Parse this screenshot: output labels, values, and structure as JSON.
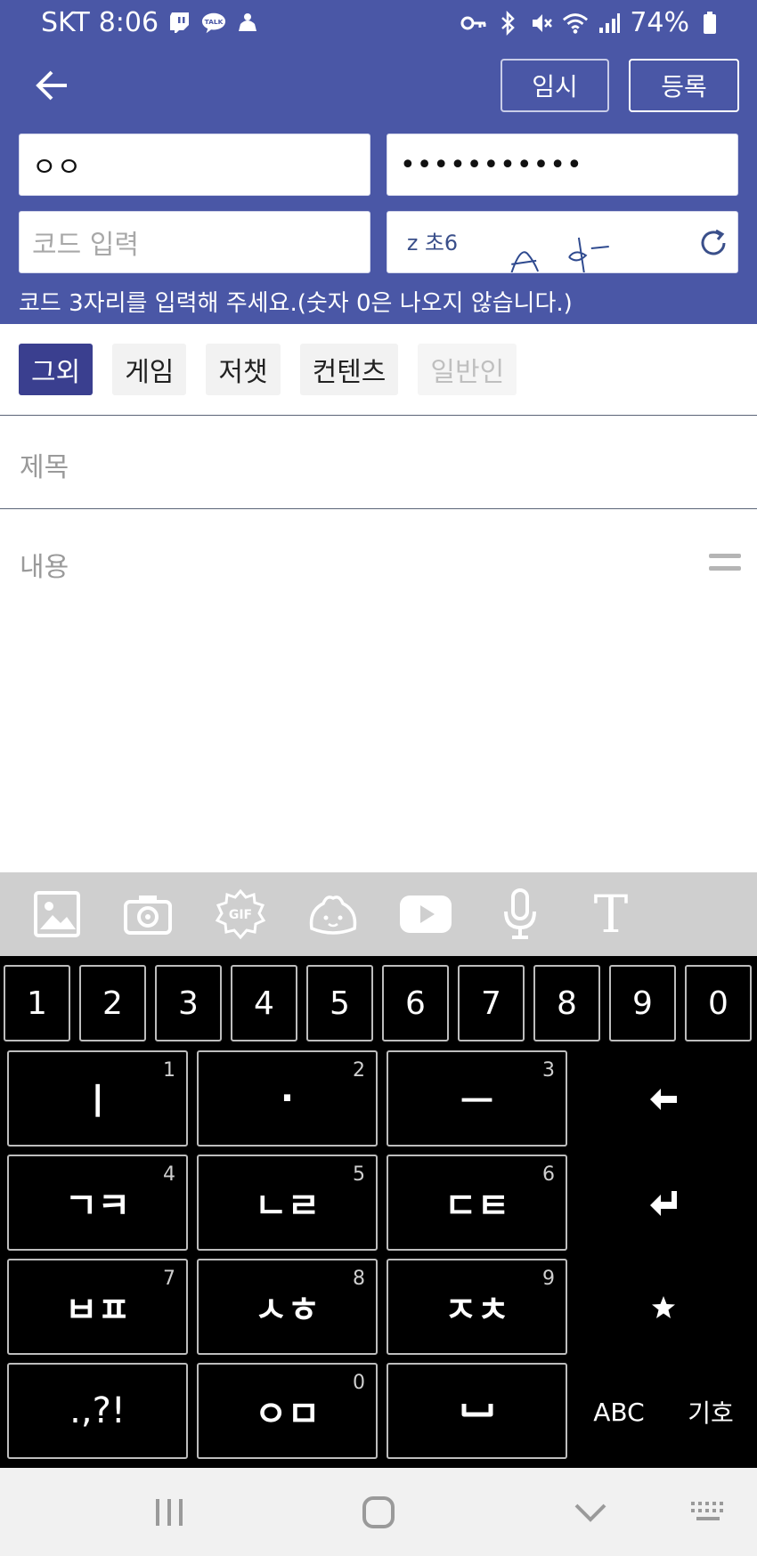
{
  "status_bar": {
    "carrier": "SKT",
    "time": "8:06",
    "battery": "74%",
    "left_icons": [
      "twitch-icon",
      "kakaotalk-icon",
      "notification-icon"
    ],
    "right_icons": [
      "key-icon",
      "bluetooth-icon",
      "mute-icon",
      "wifi-icon",
      "signal-icon",
      "battery-icon"
    ]
  },
  "header": {
    "temp_label": "임시",
    "submit_label": "등록"
  },
  "form": {
    "name_value": "ㅇㅇ",
    "password_value": "•••••••••••",
    "code_placeholder": "코드 입력",
    "captcha_text": "z 초6",
    "hint": "코드 3자리를 입력해 주세요.(숫자 0은 나오지 않습니다.)"
  },
  "tabs": [
    {
      "label": "그외",
      "state": "active"
    },
    {
      "label": "게임",
      "state": "normal"
    },
    {
      "label": "저챗",
      "state": "normal"
    },
    {
      "label": "컨텐츠",
      "state": "normal"
    },
    {
      "label": "일반인",
      "state": "disabled"
    }
  ],
  "editor": {
    "title_placeholder": "제목",
    "content_placeholder": "내용"
  },
  "toolbar": {
    "gif_label": "GIF",
    "text_label": "T",
    "items": [
      "image-icon",
      "camera-icon",
      "gif-icon",
      "emoticon-icon",
      "youtube-icon",
      "microphone-icon",
      "text-format-icon"
    ]
  },
  "keyboard": {
    "numbers": [
      "1",
      "2",
      "3",
      "4",
      "5",
      "6",
      "7",
      "8",
      "9",
      "0"
    ],
    "keys": [
      {
        "label": "ㅣ",
        "sub": "1"
      },
      {
        "label": "·",
        "sub": "2"
      },
      {
        "label": "ㅡ",
        "sub": "3"
      },
      {
        "label": "ㄱㅋ",
        "sub": "4"
      },
      {
        "label": "ㄴㄹ",
        "sub": "5"
      },
      {
        "label": "ㄷㅌ",
        "sub": "6"
      },
      {
        "label": "ㅂㅍ",
        "sub": "7"
      },
      {
        "label": "ㅅㅎ",
        "sub": "8"
      },
      {
        "label": "ㅈㅊ",
        "sub": "9"
      },
      {
        "label": ".,?!",
        "sub": ""
      },
      {
        "label": "ㅇㅁ",
        "sub": "0"
      },
      {
        "label": "␣",
        "sub": ""
      }
    ],
    "abc_label": "ABC",
    "symbol_label": "기호"
  },
  "colors": {
    "header_blue": "#4a57a6",
    "tab_active": "#3a3f8f",
    "toolbar_gray": "#cfcfcf"
  }
}
